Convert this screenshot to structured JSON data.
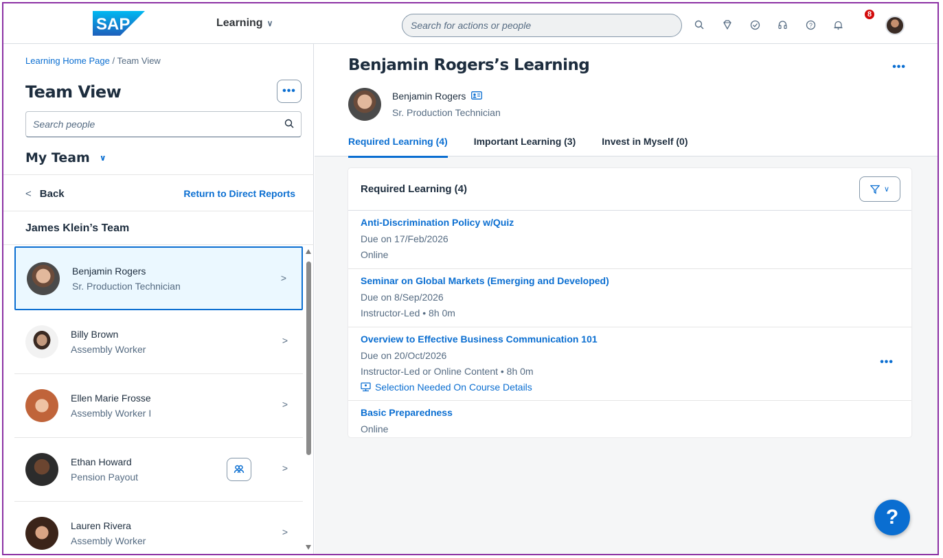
{
  "shell": {
    "brand": "SAP",
    "product": "Learning",
    "search_placeholder": "Search for actions or people",
    "notification_count": "8",
    "icons": [
      "search-icon",
      "diamond-icon",
      "check-circle-icon",
      "headset-icon",
      "help-icon",
      "bell-icon"
    ]
  },
  "left": {
    "breadcrumb": {
      "home": "Learning Home Page",
      "separator": " / ",
      "current": "Team View"
    },
    "title": "Team View",
    "more_label": "•••",
    "search_placeholder": "Search people",
    "team_selector": "My Team",
    "back_label": "Back",
    "return_label": "Return to Direct Reports",
    "team_heading": "James Klein’s Team",
    "people": [
      {
        "name": "Benjamin Rogers",
        "role": "Sr. Production Technician",
        "selected": true
      },
      {
        "name": "Billy Brown",
        "role": "Assembly Worker"
      },
      {
        "name": "Ellen Marie Frosse",
        "role": "Assembly Worker I"
      },
      {
        "name": "Ethan Howard",
        "role": "Pension Payout",
        "has_team": true
      },
      {
        "name": "Lauren Rivera",
        "role": "Assembly Worker"
      }
    ]
  },
  "right": {
    "title": "Benjamin Rogers’s Learning",
    "more_label": "•••",
    "person_name": "Benjamin Rogers",
    "person_role": "Sr. Production Technician",
    "tabs": [
      {
        "label": "Required Learning (4)",
        "active": true
      },
      {
        "label": "Important Learning (3)"
      },
      {
        "label": "Invest in Myself (0)"
      }
    ],
    "card_title": "Required Learning (4)",
    "courses": [
      {
        "title": "Anti-Discrimination Policy w/Quiz",
        "due": "Due on 17/Feb/2026",
        "type": "Online"
      },
      {
        "title": "Seminar on Global Markets (Emerging and Developed)",
        "due": "Due on 8/Sep/2026",
        "type": "Instructor-Led • 8h 0m"
      },
      {
        "title": "Overview to Effective Business Communication 101",
        "due": "Due on 20/Oct/2026",
        "type": "Instructor-Led or Online Content • 8h 0m",
        "selection": "Selection Needed On Course Details"
      },
      {
        "title": "Basic Preparedness",
        "type": "Online"
      }
    ],
    "help_label": "?"
  },
  "colors": {
    "accent": "#0a6ed1",
    "badge": "#d20a0a",
    "frame": "#8b2fa3",
    "selected_bg": "#ebf8ff"
  }
}
